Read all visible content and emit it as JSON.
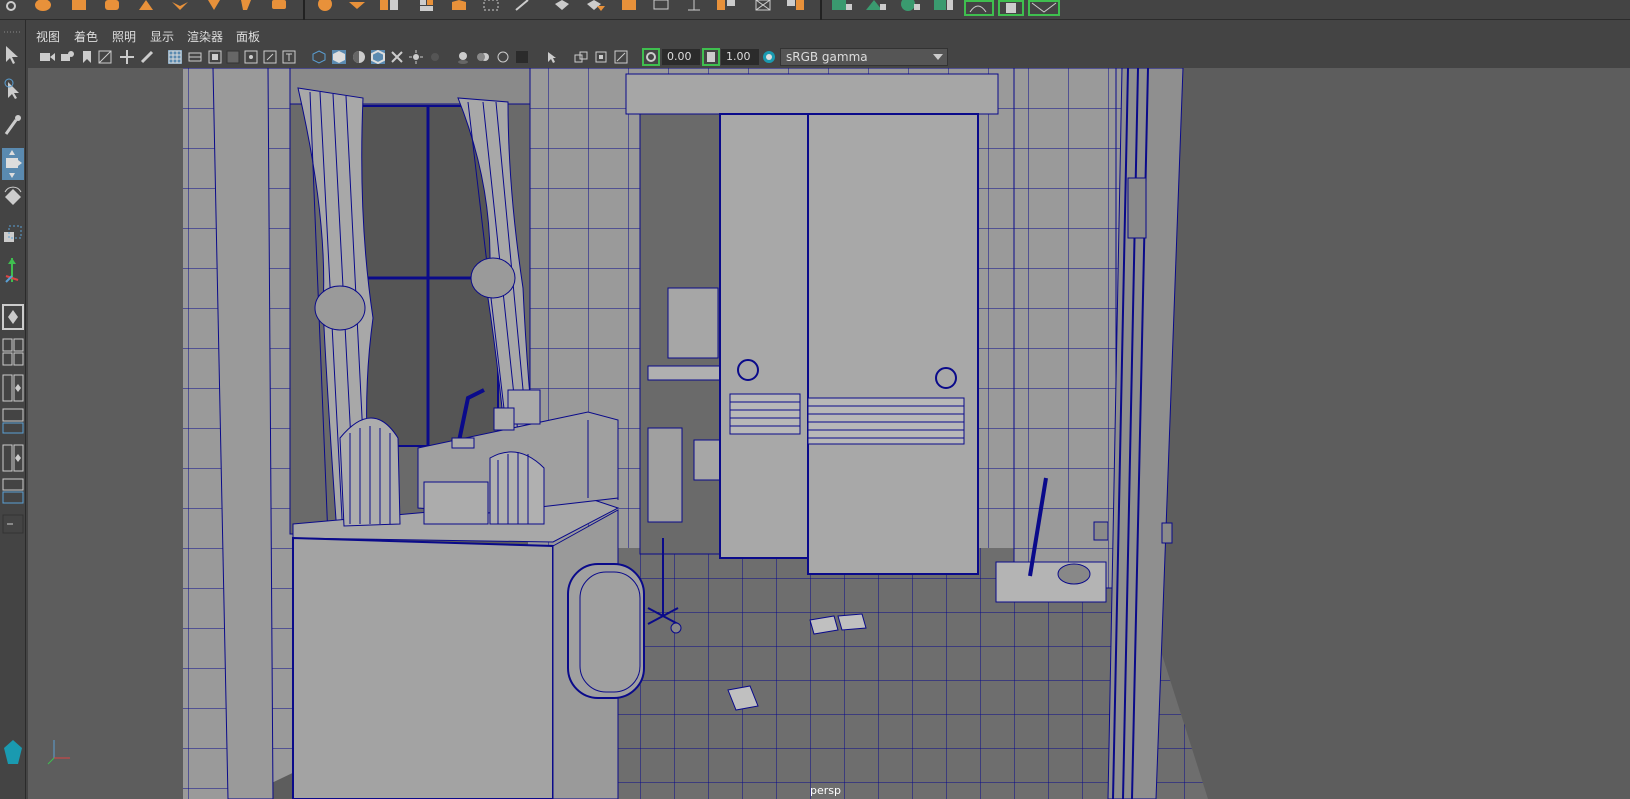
{
  "menu": {
    "items": [
      "视图",
      "着色",
      "照明",
      "显示",
      "渲染器",
      "面板"
    ]
  },
  "viewport_toolbar": {
    "exposure_value": "0.00",
    "gamma_value": "1.00",
    "colorspace": "sRGB gamma"
  },
  "viewport": {
    "camera_label": "persp"
  },
  "colors": {
    "accent_orange": "#e8913a",
    "accent_green": "#3fbf4f",
    "accent_blue": "#5a9fd4",
    "wire_blue": "#0a0a8a",
    "viewport_bg": "#5d5d5d"
  }
}
